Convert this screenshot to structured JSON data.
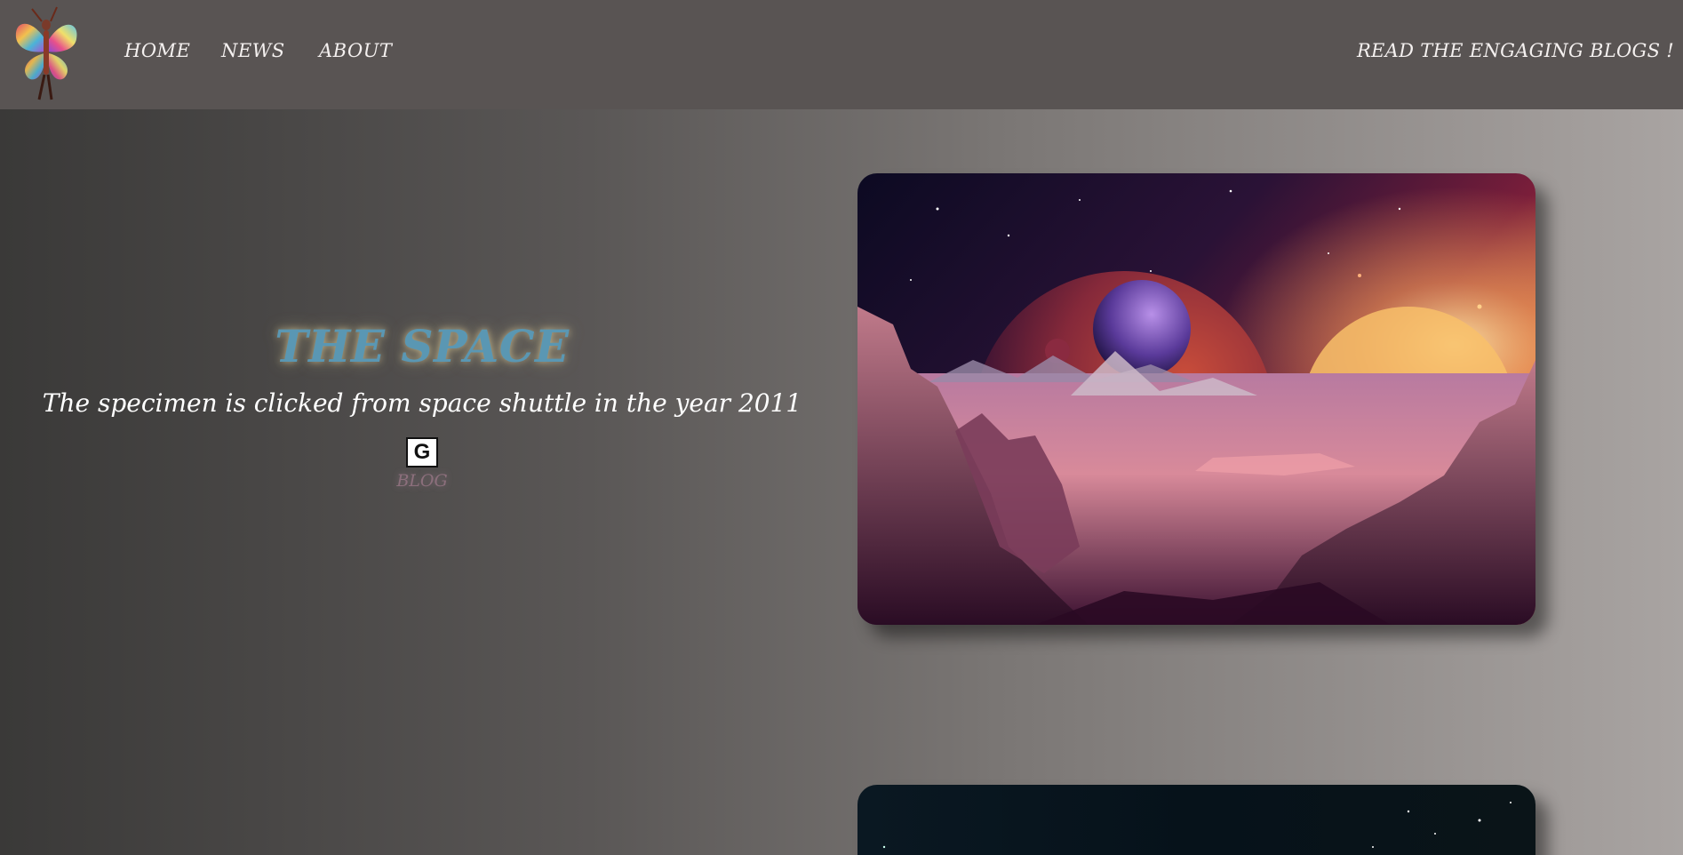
{
  "nav": {
    "home": "HOME",
    "news": "NEWS",
    "about": "ABOUT",
    "tagline": "READ THE ENGAGING BLOGS !"
  },
  "hero": {
    "title": "THE SPACE",
    "subtitle": "The specimen is clicked from space shuttle in the year 2011",
    "g_button": "G",
    "blog_link": "BLOG"
  },
  "icons": {
    "logo": "butterfly-woman-logo",
    "google": "google-g-icon"
  },
  "colors": {
    "topbar": "#595453",
    "title": "#5a97b3",
    "blog": "#8c6f7c"
  }
}
